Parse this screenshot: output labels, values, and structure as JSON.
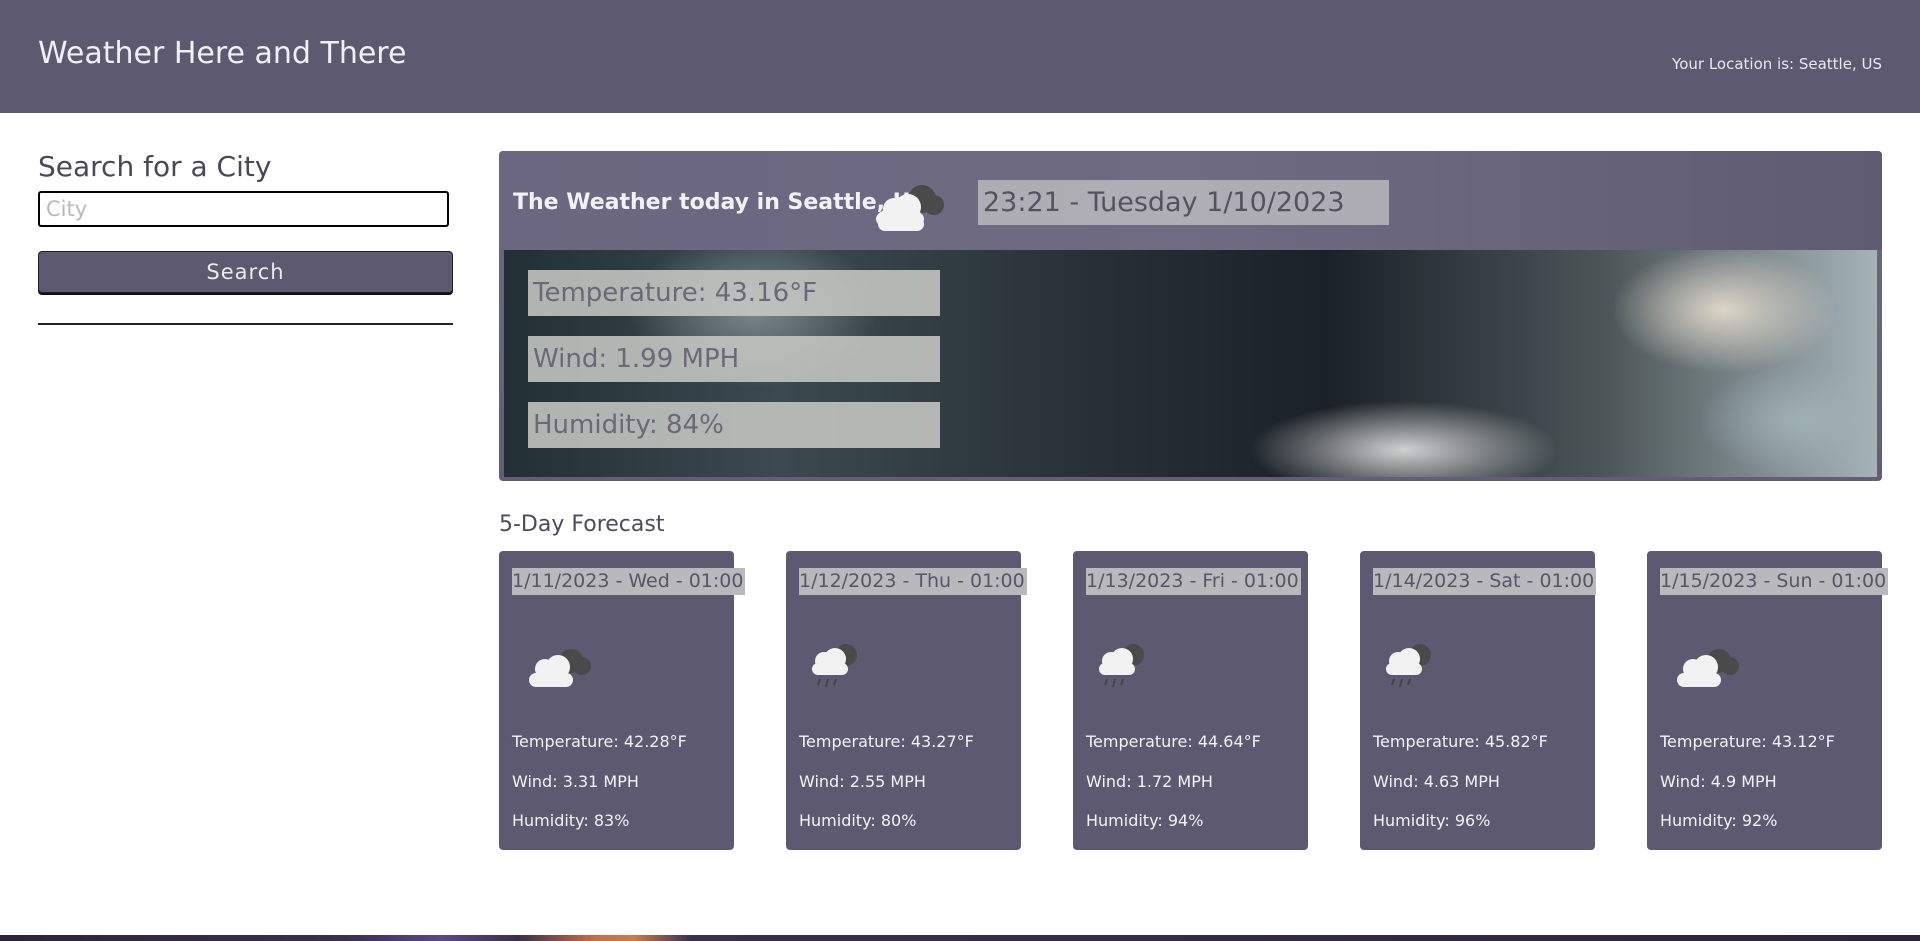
{
  "header": {
    "title": "Weather Here and There",
    "location": "Your Location is: Seattle, US"
  },
  "search": {
    "label": "Search for a City",
    "placeholder": "City",
    "value": "",
    "button_label": "Search"
  },
  "today": {
    "title": "The Weather today in Seattle, US",
    "icon": "cloud-with-moon-icon",
    "datetime": "23:21 - Tuesday 1/10/2023",
    "temperature": "Temperature: 43.16°F",
    "wind": "Wind: 1.99 MPH",
    "humidity": "Humidity: 84%"
  },
  "forecast": {
    "title": "5-Day Forecast",
    "days": [
      {
        "date": "1/11/2023 - Wed - 01:00",
        "icon": "cloud-with-moon-icon",
        "temp": "Temperature: 42.28°F",
        "wind": "Wind: 3.31 MPH",
        "humidity": "Humidity: 83%"
      },
      {
        "date": "1/12/2023 - Thu - 01:00",
        "icon": "rain-cloud-moon-icon",
        "temp": "Temperature: 43.27°F",
        "wind": "Wind: 2.55 MPH",
        "humidity": "Humidity: 80%"
      },
      {
        "date": "1/13/2023 - Fri - 01:00",
        "icon": "rain-cloud-moon-icon",
        "temp": "Temperature: 44.64°F",
        "wind": "Wind: 1.72 MPH",
        "humidity": "Humidity: 94%"
      },
      {
        "date": "1/14/2023 - Sat - 01:00",
        "icon": "rain-cloud-moon-icon",
        "temp": "Temperature: 45.82°F",
        "wind": "Wind: 4.63 MPH",
        "humidity": "Humidity: 96%"
      },
      {
        "date": "1/15/2023 - Sun - 01:00",
        "icon": "cloud-with-moon-icon",
        "temp": "Temperature: 43.12°F",
        "wind": "Wind: 4.9 MPH",
        "humidity": "Humidity: 92%"
      }
    ]
  },
  "colors": {
    "primary": "#5d5970",
    "header_text": "#f1f0f5",
    "label_bg": "#b9b8bd"
  }
}
